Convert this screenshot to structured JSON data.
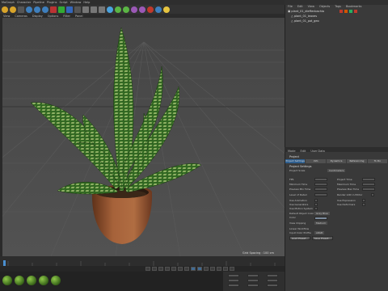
{
  "menubar": {
    "items": [
      "MoGraph",
      "Character",
      "Pipeline",
      "Plugins",
      "Script",
      "Window",
      "Help"
    ]
  },
  "viewport": {
    "tabs": [
      "View",
      "Cameras",
      "Display",
      "Options",
      "Filter",
      "Panel"
    ],
    "status": "Grid Spacing : 100 cm"
  },
  "object_manager": {
    "menu": [
      "File",
      "Edit",
      "View",
      "Objects",
      "Tags",
      "Bookmarks"
    ],
    "objects": [
      "plant_01_dieffenbachia",
      "plant_01_leaves",
      "plant_01_pot_geo"
    ]
  },
  "attribute_manager": {
    "menu": [
      "Mode",
      "Edit",
      "User Data"
    ],
    "title": "Project",
    "tabs": [
      "Project Settings",
      "Info",
      "Dynamics",
      "Referencing",
      "To Do"
    ],
    "section": "Project Settings",
    "properties_left": [
      "Project Scale",
      "FPS",
      "Minimum Time",
      "Preview Min Time",
      "Level of Detail",
      "Use Animation",
      "Use Generators",
      "Use Motion System",
      "Default Object Color",
      "Color",
      "View Clipping",
      "Linear Workflow",
      "Input Color Profile"
    ],
    "properties_right": [
      "Project Time",
      "Maximum Time",
      "Preview Max Time",
      "Render LOD in Editor",
      "Use Expression",
      "Use Deformers"
    ],
    "values": {
      "project_scale": "Centimeters",
      "default_object_color": "Gray Blue",
      "view_clipping": "Medium",
      "input_color_profile": "sRGB"
    },
    "buttons": [
      "Load Preset...",
      "Save Preset..."
    ]
  },
  "colors": {
    "panel": "#3a3a3a",
    "accent": "#2f5f8f",
    "pot": "#9c5a35",
    "leaf_dark": "#2f6a22",
    "leaf_light": "#c9dc8a"
  }
}
